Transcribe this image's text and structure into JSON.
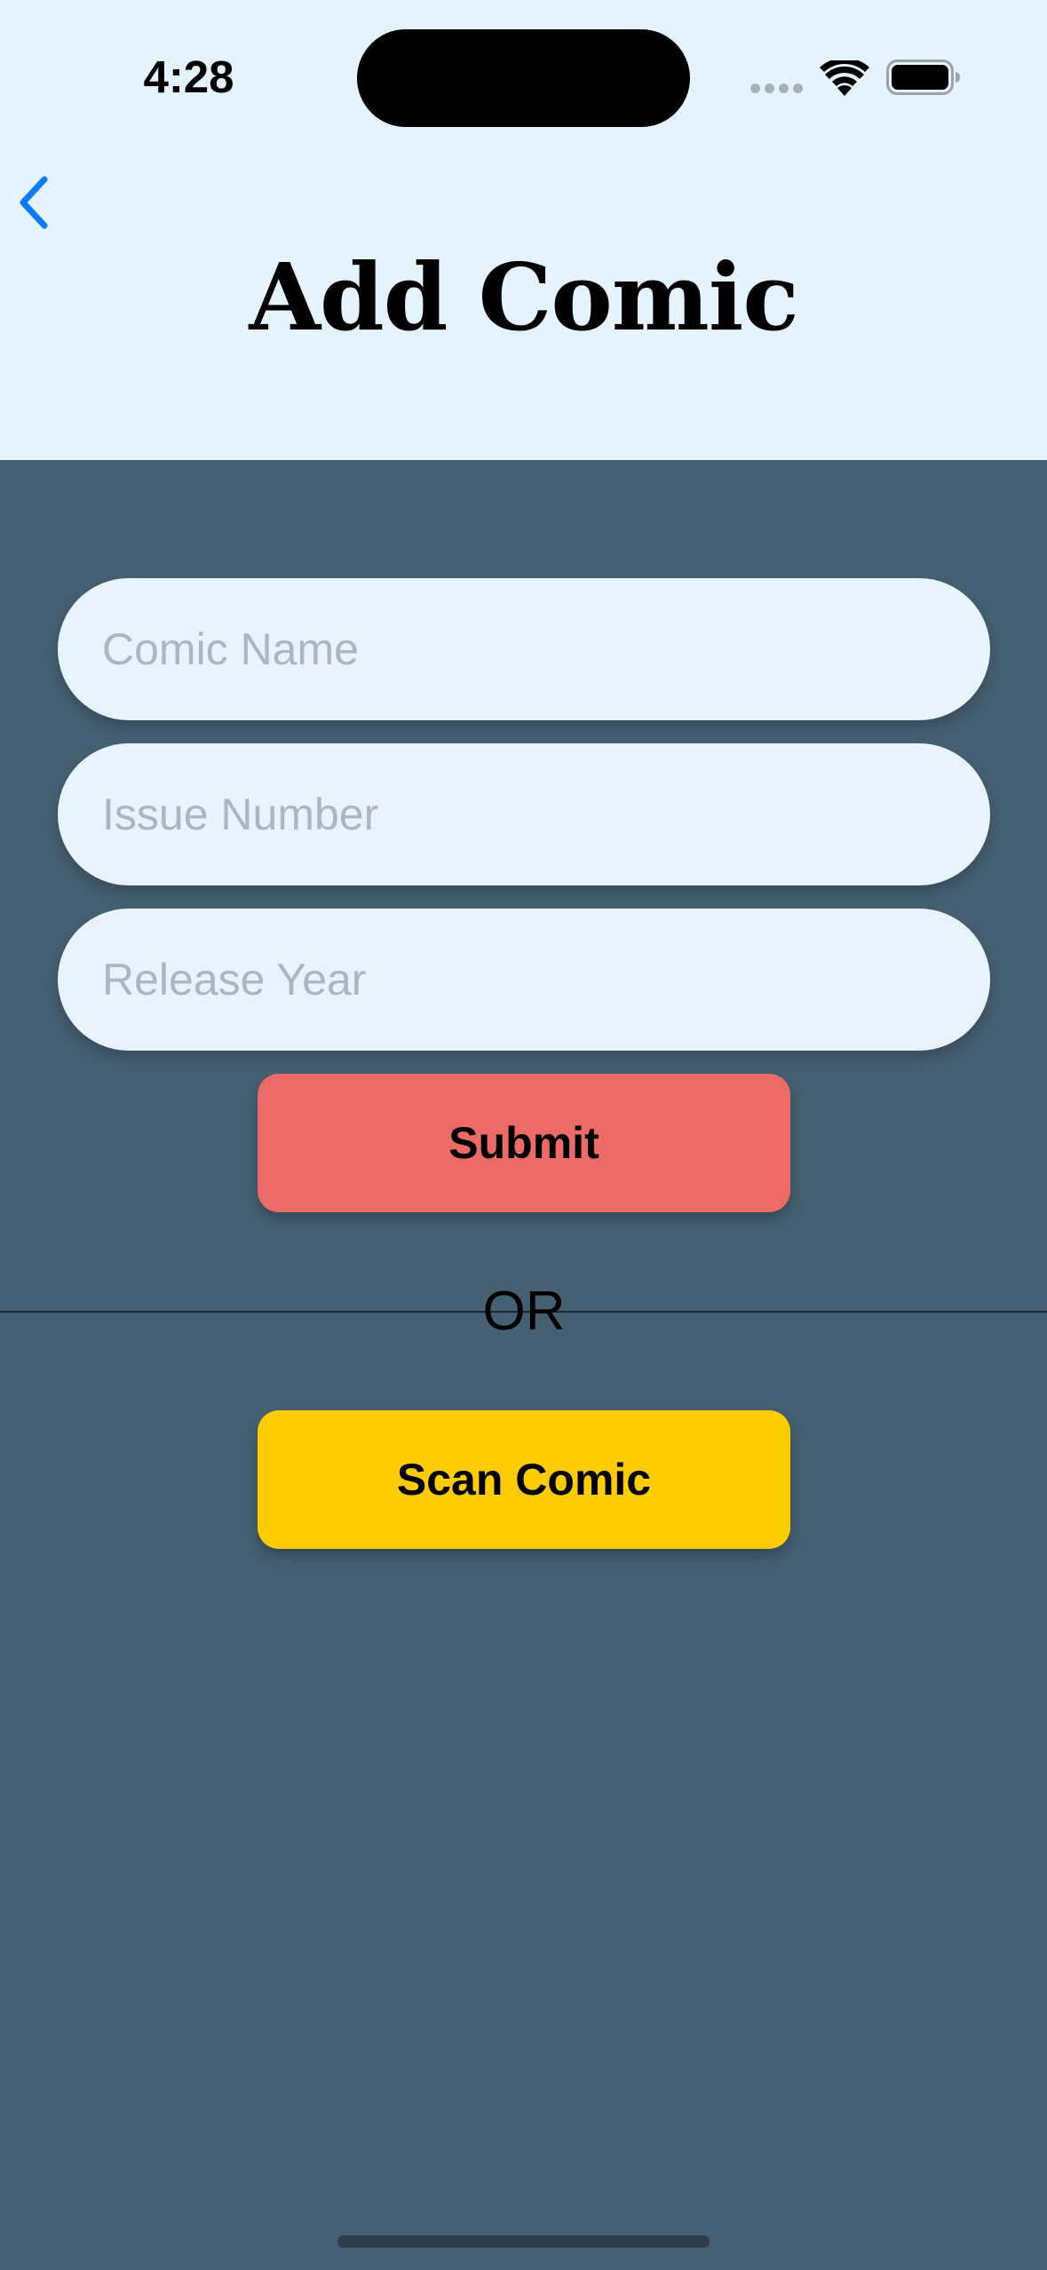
{
  "status_bar": {
    "time": "4:28"
  },
  "nav": {
    "back_icon": "chevron-left-icon",
    "title": "Add Comic"
  },
  "form": {
    "comic_name_placeholder": "Comic Name",
    "issue_number_placeholder": "Issue Number",
    "release_year_placeholder": "Release Year",
    "submit_label": "Submit"
  },
  "separator": {
    "or_label": "OR"
  },
  "scan": {
    "label": "Scan Comic"
  },
  "colors": {
    "header_background": "#e5f3ff",
    "body_background": "#466073",
    "submit_button": "#ec6b66",
    "scan_button": "#ffcc00",
    "accent_blue": "#0a7aff"
  }
}
